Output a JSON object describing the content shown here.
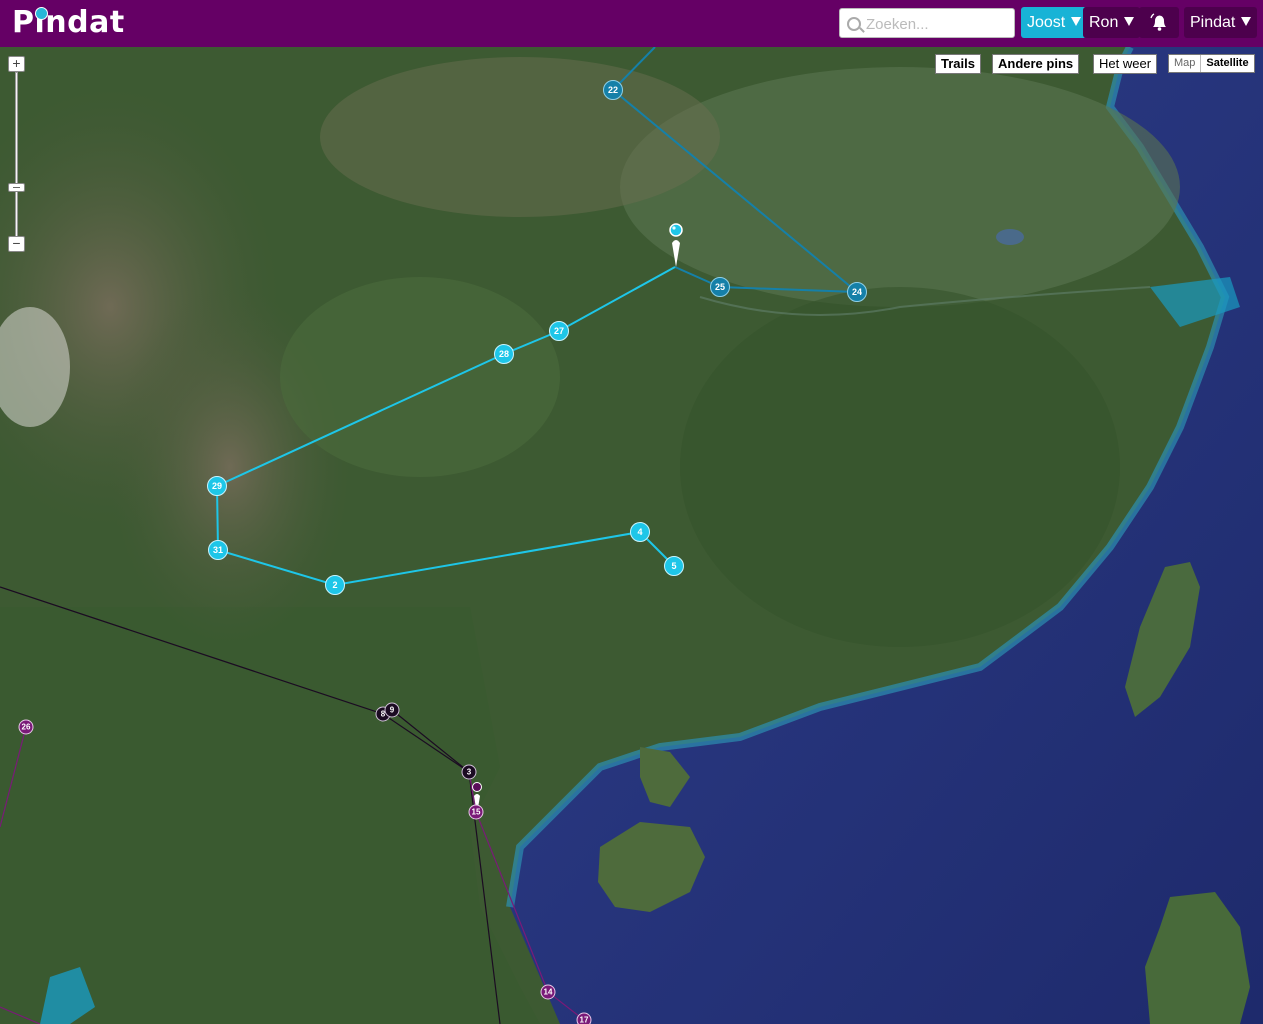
{
  "header": {
    "logo_text": "Pindat",
    "search_placeholder": "Zoeken...",
    "user_menus": [
      {
        "label": "Joost",
        "active": true
      },
      {
        "label": "Ron",
        "active": false
      }
    ],
    "notifications_icon": "bell-icon",
    "app_menu_label": "Pindat"
  },
  "map_controls": {
    "toggles": [
      "Trails",
      "Andere pins",
      "Het weer"
    ],
    "map_type": {
      "options": [
        "Map",
        "Satellite"
      ],
      "selected": "Satellite"
    },
    "zoom": {
      "in_label": "+",
      "out_label": "−"
    }
  },
  "colors": {
    "header_bg": "#650065",
    "active_user": "#18b3d6",
    "trail_cyan": "#1ec6e8",
    "trail_blue": "#1580a8",
    "trail_dark": "#1b0b22",
    "trail_purple": "#7a1a78"
  },
  "markers": {
    "cyan": [
      "29",
      "31",
      "2",
      "4",
      "5",
      "28",
      "27"
    ],
    "blue": [
      "22",
      "25",
      "24"
    ],
    "dark": [
      "8",
      "9",
      "3",
      "15"
    ],
    "purple": [
      "26",
      "14",
      "17"
    ]
  }
}
